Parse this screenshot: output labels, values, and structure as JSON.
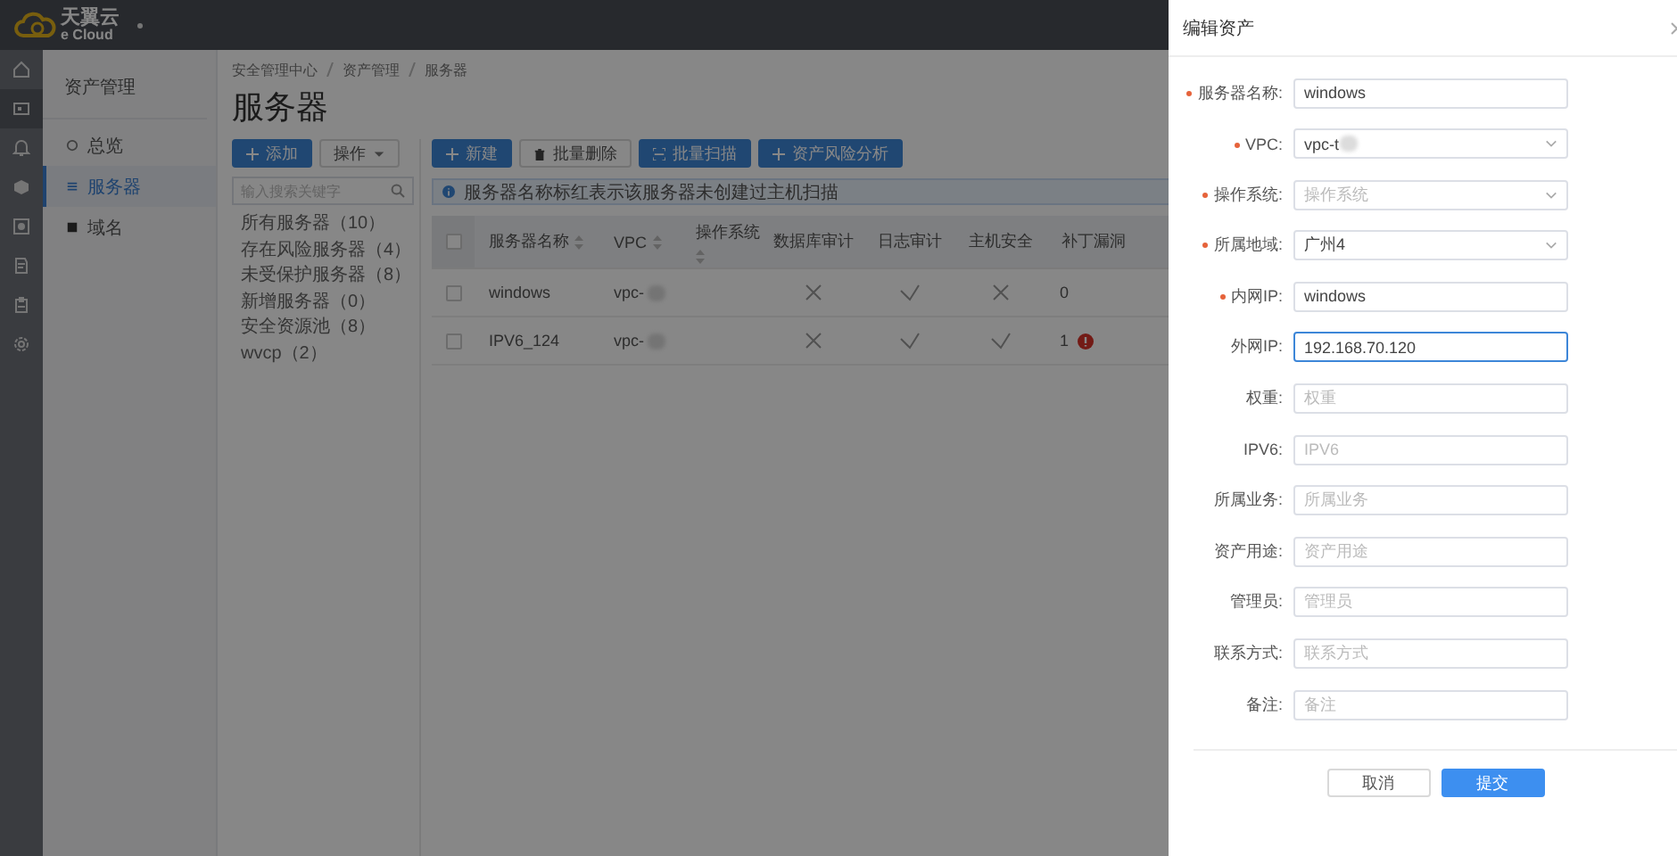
{
  "header": {
    "logo_text": "天翼云",
    "logo_subtext": "e Cloud"
  },
  "rail": [
    {
      "kind": "home",
      "selected": false
    },
    {
      "kind": "monitor",
      "selected": true
    },
    {
      "kind": "bell",
      "selected": false
    },
    {
      "kind": "shield",
      "selected": false
    },
    {
      "kind": "box",
      "selected": false
    },
    {
      "kind": "document",
      "selected": false
    },
    {
      "kind": "clipboard",
      "selected": false
    },
    {
      "kind": "gear",
      "selected": false
    }
  ],
  "subnav": {
    "title": "资产管理",
    "items": [
      {
        "label": "总览",
        "kind": "overview",
        "selected": false
      },
      {
        "label": "服务器",
        "kind": "server",
        "selected": true
      },
      {
        "label": "域名",
        "kind": "domain",
        "selected": false
      }
    ]
  },
  "breadcrumb": [
    "安全管理中心",
    "资产管理",
    "服务器"
  ],
  "page_title": "服务器",
  "tree": {
    "buttons": [
      {
        "label": "添加",
        "kind": "add",
        "primary": true
      },
      {
        "label": "操作",
        "kind": "dropdown",
        "primary": false
      }
    ],
    "search": {
      "placeholder": "输入搜索关键字"
    },
    "items": [
      "所有服务器（10）",
      "存在风险服务器（4）",
      "未受保护服务器（8）",
      "新增服务器（0）",
      "安全资源池（8）",
      "wvcp（2）"
    ]
  },
  "toolbar": [
    {
      "label": "新建",
      "kind": "add",
      "primary": true
    },
    {
      "label": "批量删除",
      "kind": "delete",
      "primary": false
    },
    {
      "label": "批量扫描",
      "kind": "scan",
      "primary": true
    },
    {
      "label": "资产风险分析",
      "kind": "add",
      "primary": true
    }
  ],
  "notice": "服务器名称标红表示该服务器未创建过主机扫描",
  "table": {
    "columns": [
      {
        "label": "服务器名称",
        "sortable": true
      },
      {
        "label": "VPC",
        "sortable": true
      },
      {
        "label": "操作系统",
        "sortable": true
      },
      {
        "label": "数据库审计",
        "sortable": false
      },
      {
        "label": "日志审计",
        "sortable": false
      },
      {
        "label": "主机安全",
        "sortable": false
      },
      {
        "label": "补丁漏洞",
        "sortable": false
      }
    ],
    "all_checked": false,
    "rows": [
      {
        "checked": false,
        "name": "windows",
        "vpc": "vpc-",
        "redacted": true,
        "database_audit": false,
        "log_audit": true,
        "host_security": false,
        "patch": "0",
        "patch_alert": false
      },
      {
        "checked": false,
        "name": "IPV6_124",
        "vpc": "vpc-",
        "redacted": true,
        "database_audit": false,
        "log_audit": true,
        "host_security": true,
        "patch": "1",
        "patch_alert": true
      }
    ]
  },
  "drawer": {
    "mask": true,
    "title": "编辑资产",
    "fields": [
      {
        "label": "服务器名称:",
        "required": true,
        "kind": "input",
        "value": "windows",
        "redacted": false,
        "focused": false
      },
      {
        "label": "VPC:",
        "required": true,
        "kind": "select",
        "value": "vpc-t",
        "redacted": true,
        "focused": false
      },
      {
        "label": "操作系统:",
        "required": true,
        "kind": "select",
        "placeholder": "操作系统",
        "redacted": false,
        "focused": false
      },
      {
        "label": "所属地域:",
        "required": true,
        "kind": "select",
        "value": "广州4",
        "redacted": false,
        "focused": false
      },
      {
        "label": "内网IP:",
        "required": true,
        "kind": "input",
        "value": "windows",
        "redacted": false,
        "focused": false
      },
      {
        "label": "外网IP:",
        "required": false,
        "kind": "input",
        "value": "192.168.70.120",
        "redacted": false,
        "focused": true
      },
      {
        "label": "权重:",
        "required": false,
        "kind": "input",
        "placeholder": "权重",
        "redacted": false,
        "focused": false
      },
      {
        "label": "IPV6:",
        "required": false,
        "kind": "input",
        "placeholder": "IPV6",
        "redacted": false,
        "focused": false
      },
      {
        "label": "所属业务:",
        "required": false,
        "kind": "input",
        "placeholder": "所属业务",
        "redacted": false,
        "focused": false
      },
      {
        "label": "资产用途:",
        "required": false,
        "kind": "input",
        "placeholder": "资产用途",
        "redacted": false,
        "focused": false
      },
      {
        "label": "管理员:",
        "required": false,
        "kind": "input",
        "placeholder": "管理员",
        "redacted": false,
        "focused": false
      },
      {
        "label": "联系方式:",
        "required": false,
        "kind": "input",
        "placeholder": "联系方式",
        "redacted": false,
        "focused": false
      },
      {
        "label": "备注:",
        "required": false,
        "kind": "input",
        "placeholder": "备注",
        "redacted": false,
        "focused": false
      }
    ],
    "buttons": [
      {
        "label": "取消",
        "kind": "default"
      },
      {
        "label": "提交",
        "kind": "primary"
      }
    ]
  }
}
